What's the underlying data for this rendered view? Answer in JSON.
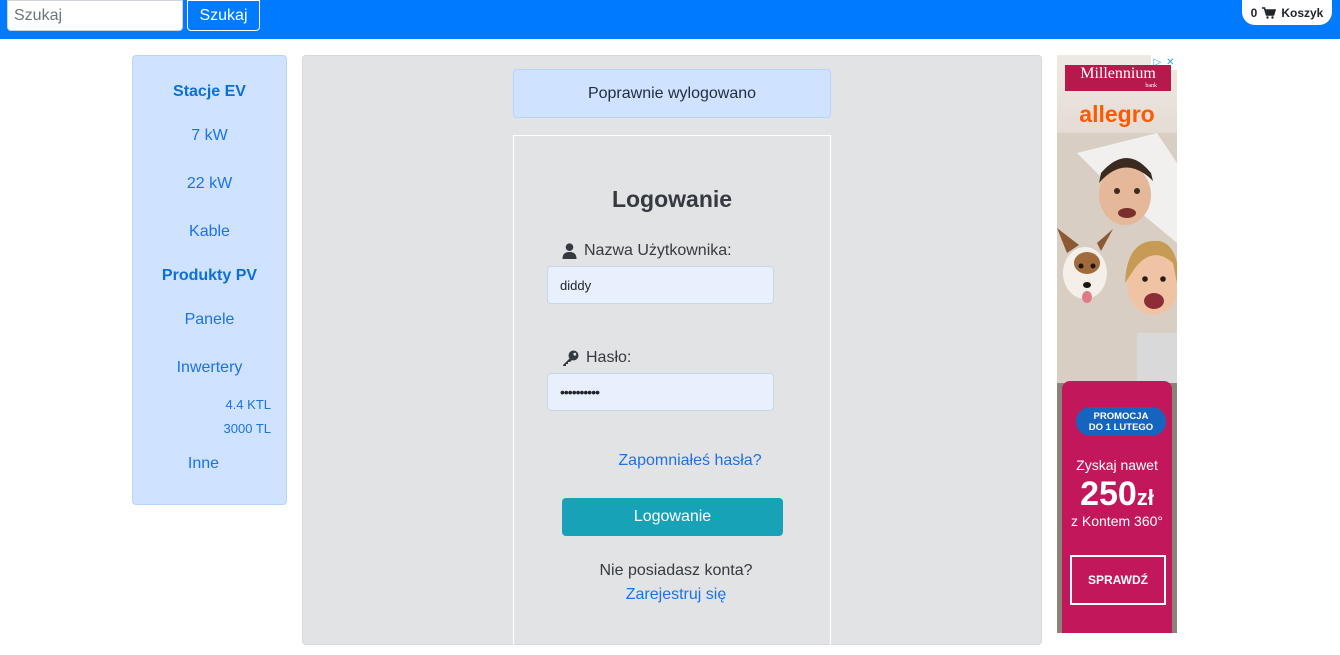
{
  "header": {
    "search_placeholder": "Szukaj",
    "search_button": "Szukaj",
    "cart_count": "0",
    "cart_label": "Koszyk",
    "cart_icon": "shopping-cart-icon",
    "bar_color": "#007bff"
  },
  "sidebar": {
    "items": [
      {
        "label": "Stacje EV",
        "type": "category"
      },
      {
        "label": "7 kW",
        "type": "link"
      },
      {
        "label": "22 kW",
        "type": "link"
      },
      {
        "label": "Kable",
        "type": "link"
      },
      {
        "label": "Produkty PV",
        "type": "category"
      },
      {
        "label": "Panele",
        "type": "link"
      },
      {
        "label": "Inwertery",
        "type": "link"
      },
      {
        "label": "4.4 KTL",
        "type": "sublink"
      },
      {
        "label": "3000 TL",
        "type": "sublink"
      },
      {
        "label": "Inne",
        "type": "link"
      }
    ]
  },
  "main": {
    "alert": "Poprawnie wylogowano",
    "login": {
      "title": "Logowanie",
      "username_label": "Nazwa Użytkownika:",
      "username_value": "diddy",
      "username_icon": "user-icon",
      "password_label": "Hasło:",
      "password_value": "••••••••••",
      "password_icon": "key-icon",
      "forgot_link": "Zapomniałeś hasła?",
      "submit": "Logowanie",
      "no_account": "Nie posiadasz konta?",
      "register_link": "Zarejestruj się"
    }
  },
  "ad": {
    "bank": "Millennium",
    "bank_sub": "bank",
    "brand": "allegro",
    "promo_line1": "PROMOCJA",
    "promo_line2": "DO 1 LUTEGO",
    "text1": "Zyskaj nawet",
    "amount": "250",
    "currency": "zł",
    "text2": "z Kontem 360°",
    "cta": "SPRAWDŹ",
    "adchoices_icon": "adchoices-icon",
    "close_icon": "close-icon"
  }
}
